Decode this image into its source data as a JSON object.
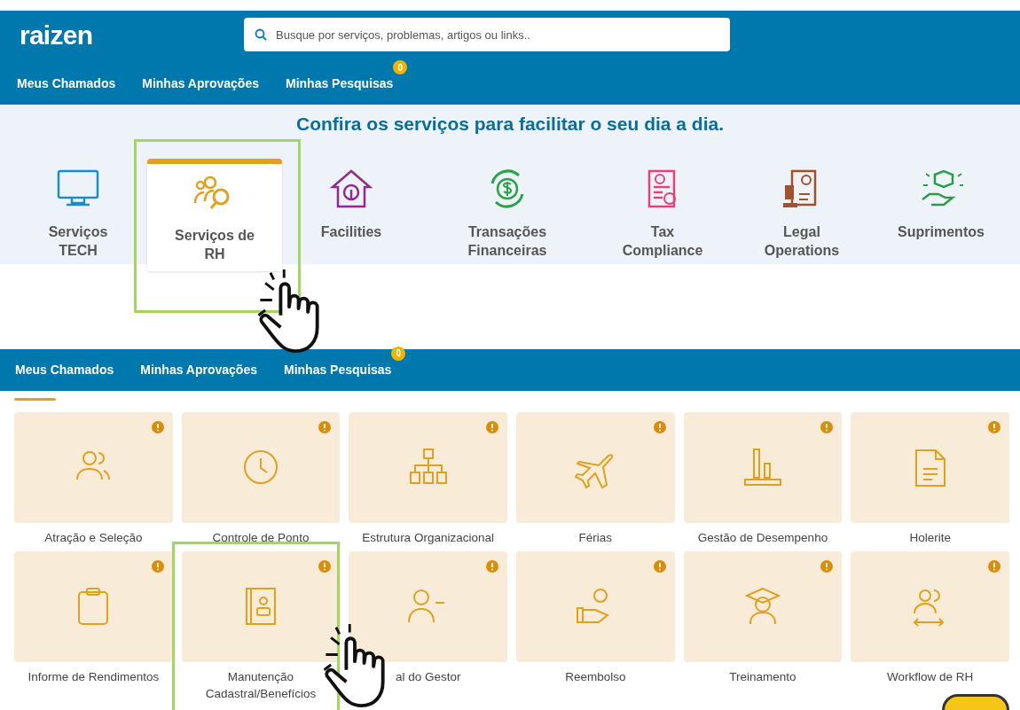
{
  "header": {
    "logo": "raizen",
    "search": {
      "placeholder": "Busque por serviços, problemas, artigos ou links.."
    },
    "nav": [
      {
        "label": "Meus Chamados"
      },
      {
        "label": "Minhas Aprovações"
      },
      {
        "label": "Minhas Pesquisas",
        "badge": "0"
      }
    ]
  },
  "banner": {
    "title": "Confira os serviços para facilitar o seu dia a dia.",
    "categories": [
      {
        "label": "Serviços TECH",
        "selected": false
      },
      {
        "label": "Serviços de RH",
        "selected": true
      },
      {
        "label": "Facilities",
        "selected": false
      },
      {
        "label": "Transações Financeiras",
        "selected": false
      },
      {
        "label": "Tax Compliance",
        "selected": false
      },
      {
        "label": "Legal Operations",
        "selected": false
      },
      {
        "label": "Suprimentos",
        "selected": false
      }
    ]
  },
  "nav_2": [
    {
      "label": "Meus Chamados"
    },
    {
      "label": "Minhas Aprovações"
    },
    {
      "label": "Minhas Pesquisas",
      "badge": "0"
    }
  ],
  "tiles": [
    {
      "label": "Atração e Seleção"
    },
    {
      "label": "Controle de Ponto"
    },
    {
      "label": "Estrutura Organizacional"
    },
    {
      "label": "Férias"
    },
    {
      "label": "Gestão de Desempenho"
    },
    {
      "label": "Holerite"
    },
    {
      "label": "Informe de Rendimentos"
    },
    {
      "label": "Manutenção Cadastral/Benefícios"
    },
    {
      "label": "al do Gestor"
    },
    {
      "label": "Reembolso"
    },
    {
      "label": "Treinamento"
    },
    {
      "label": "Workflow de RH"
    }
  ]
}
